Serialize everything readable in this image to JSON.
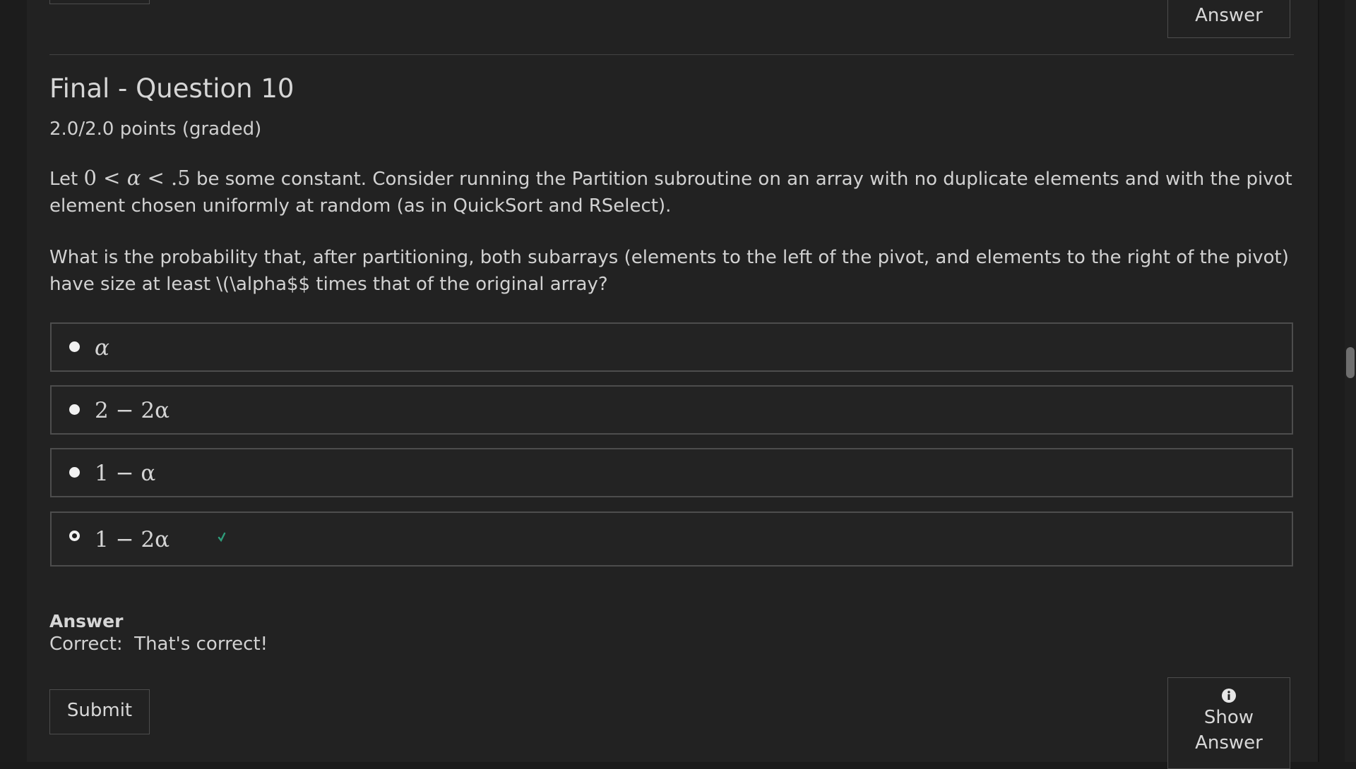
{
  "top": {
    "answer_button_label": "Answer"
  },
  "question": {
    "title": "Final - Question 10",
    "points": "2.0/2.0 points (graded)",
    "p1_before": "Let ",
    "p1_math_0": "0",
    "p1_math_lt1": " < ",
    "p1_math_alpha": "α",
    "p1_math_lt2": " < ",
    "p1_math_5": ".5",
    "p1_after": " be some constant. Consider running the Partition subroutine on an array with no duplicate elements and with the pivot element chosen uniformly at random (as in QuickSort and RSelect).",
    "p2": "What is the probability that, after partitioning, both subarrays (elements to the left of the pivot, and elements to the right of the pivot) have size at least \\(\\alpha$$ times that of the original array?"
  },
  "options": [
    {
      "math": "α",
      "selected": false
    },
    {
      "math": "2 − 2α",
      "selected": false
    },
    {
      "math": "1 − α",
      "selected": false
    },
    {
      "math": "1 − 2α",
      "selected": true
    }
  ],
  "answer": {
    "label": "Answer",
    "status": "Correct: ",
    "message": " That's correct!"
  },
  "buttons": {
    "submit": "Submit",
    "show_answer_line1": "Show",
    "show_answer_line2": "Answer"
  },
  "colors": {
    "background": "#222222",
    "text": "#d2d2d2",
    "border": "#4d4d4d",
    "correct_icon": "#2e9c7a"
  },
  "icons": {
    "correct": "check-icon",
    "info": "info-icon"
  }
}
